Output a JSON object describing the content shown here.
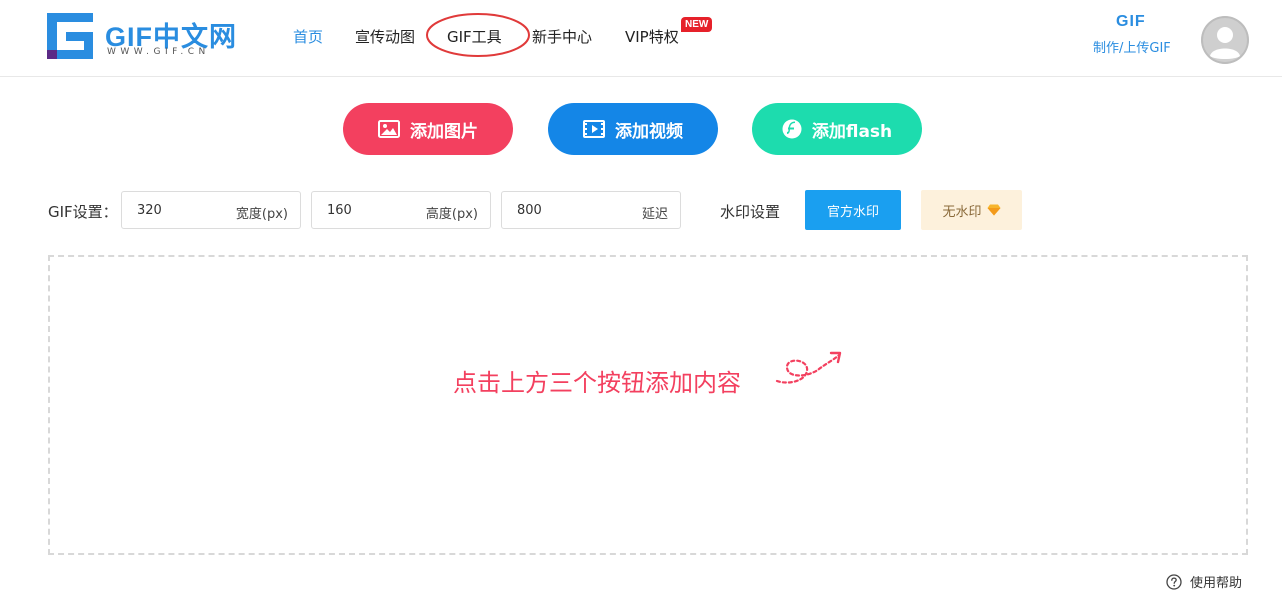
{
  "header": {
    "logo": {
      "text": "GIF中文网",
      "subtext": "WWW.GIF.CN"
    },
    "nav": [
      {
        "label": "首页",
        "active": true
      },
      {
        "label": "宣传动图",
        "active": false
      },
      {
        "label": "GIF工具",
        "active": false
      },
      {
        "label": "新手中心",
        "active": false
      },
      {
        "label": "VIP特权",
        "active": false
      }
    ],
    "vip_badge": "NEW",
    "maker": {
      "title": "GIF",
      "subtitle": "制作/上传GIF"
    },
    "avatar_icon": "user-avatar-icon"
  },
  "actions": [
    {
      "label": "添加图片",
      "icon": "image-icon",
      "color": "#f3405f"
    },
    {
      "label": "添加视频",
      "icon": "video-icon",
      "color": "#1486e7"
    },
    {
      "label": "添加flash",
      "icon": "flash-icon",
      "color": "#1ddcae"
    }
  ],
  "settings": {
    "label": "GIF设置：",
    "width": {
      "value": "320",
      "unit": "宽度(px)"
    },
    "height": {
      "value": "160",
      "unit": "高度(px)"
    },
    "delay": {
      "value": "800",
      "unit": "延迟"
    }
  },
  "watermark": {
    "label": "水印设置",
    "official": "官方水印",
    "none": "无水印",
    "none_icon": "diamond-icon"
  },
  "dropzone": {
    "hint": "点击上方三个按钮添加内容"
  },
  "help": {
    "label": "使用帮助",
    "icon": "question-circle-icon"
  },
  "colors": {
    "brand_blue": "#2a8de0",
    "accent_red": "#f3405f",
    "annotation_red": "#e03a3a"
  }
}
